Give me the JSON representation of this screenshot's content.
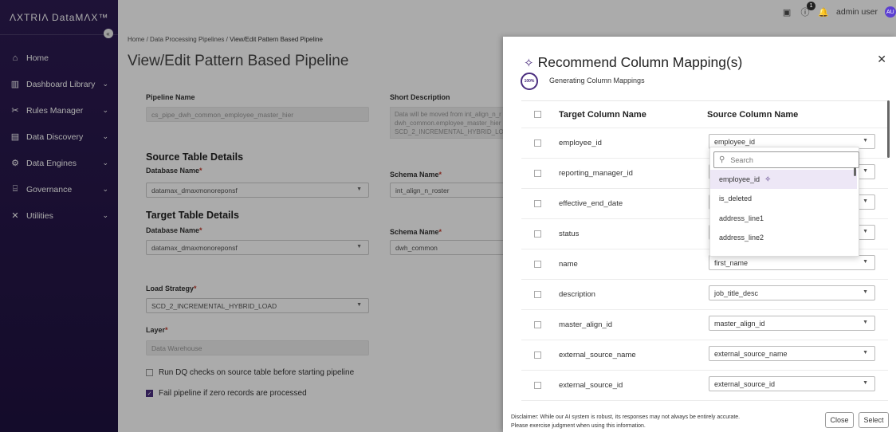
{
  "app": {
    "logo": "ΛXTRIΛ DataMΛX™"
  },
  "sidebar": {
    "items": [
      {
        "label": "Home",
        "icon": "home-icon",
        "glyph": "⌂"
      },
      {
        "label": "Dashboard Library",
        "icon": "chart-icon",
        "glyph": "▥"
      },
      {
        "label": "Rules Manager",
        "icon": "tools-icon",
        "glyph": "✂"
      },
      {
        "label": "Data Discovery",
        "icon": "document-icon",
        "glyph": "▤"
      },
      {
        "label": "Data Engines",
        "icon": "engine-icon",
        "glyph": "⚙"
      },
      {
        "label": "Governance",
        "icon": "governance-icon",
        "glyph": "⌸"
      },
      {
        "label": "Utilities",
        "icon": "utilities-icon",
        "glyph": "✕"
      }
    ]
  },
  "breadcrumb": {
    "home": "Home",
    "sep": "/",
    "section": "Data Processing Pipelines",
    "current": "View/Edit Pattern Based Pipeline"
  },
  "page": {
    "title": "View/Edit Pattern Based Pipeline",
    "pipeline_name_label": "Pipeline Name",
    "pipeline_name_value": "cs_pipe_dwh_common_employee_master_hier",
    "short_desc_label": "Short Description",
    "short_desc_lines": [
      "Data will be moved from int_align_n_r",
      "dwh_common.employee_master_hier",
      "SCD_2_INCREMENTAL_HYBRID_LOA"
    ],
    "source_section": "Source Table Details",
    "source_db_label": "Database Name",
    "source_db_value": "datamax_dmaxmonoreponsf",
    "source_schema_label": "Schema Name",
    "source_schema_value": "int_align_n_roster",
    "target_section": "Target Table Details",
    "target_db_label": "Database Name",
    "target_db_value": "datamax_dmaxmonoreponsf",
    "target_schema_label": "Schema Name",
    "target_schema_value": "dwh_common",
    "load_strategy_label": "Load Strategy",
    "load_strategy_value": "SCD_2_INCREMENTAL_HYBRID_LOAD",
    "layer_label": "Layer",
    "layer_value": "Data Warehouse",
    "dq_check_label": "Run DQ checks on source table before starting pipeline",
    "dq_check_checked": false,
    "fail_label": "Fail pipeline if zero records are processed",
    "fail_checked": true,
    "required_mark": "*"
  },
  "topbar": {
    "user": "admin user",
    "notification_count": "1",
    "avatar_initials": "AU"
  },
  "panel": {
    "title": "Recommend Column Mapping(s)",
    "progress": "100%",
    "status": "Generating Column Mappings",
    "col_target": "Target Column Name",
    "col_source": "Source Column Name",
    "rows": [
      {
        "target": "employee_id",
        "source": "employee_id"
      },
      {
        "target": "reporting_manager_id",
        "source": ""
      },
      {
        "target": "effective_end_date",
        "source": ""
      },
      {
        "target": "status",
        "source": ""
      },
      {
        "target": "name",
        "source": "first_name"
      },
      {
        "target": "description",
        "source": "job_title_desc"
      },
      {
        "target": "master_align_id",
        "source": "master_align_id"
      },
      {
        "target": "external_source_name",
        "source": "external_source_name"
      },
      {
        "target": "external_source_id",
        "source": "external_source_id"
      }
    ],
    "dropdown": {
      "search_placeholder": "Search",
      "options": [
        "employee_id",
        "is_deleted",
        "address_line1",
        "address_line2"
      ],
      "active_index": 0
    },
    "disclaimer_line1": "Disclaimer: While our AI system is robust, its responses may not always be entirely accurate.",
    "disclaimer_line2": "Please exercise judgment when using this information.",
    "close_label": "Close",
    "select_label": "Select"
  },
  "colors": {
    "brand": "#4a2d7e",
    "sidebar": "#2d1b52",
    "avatar": "#5b3fd1",
    "required": "#c0392b"
  }
}
